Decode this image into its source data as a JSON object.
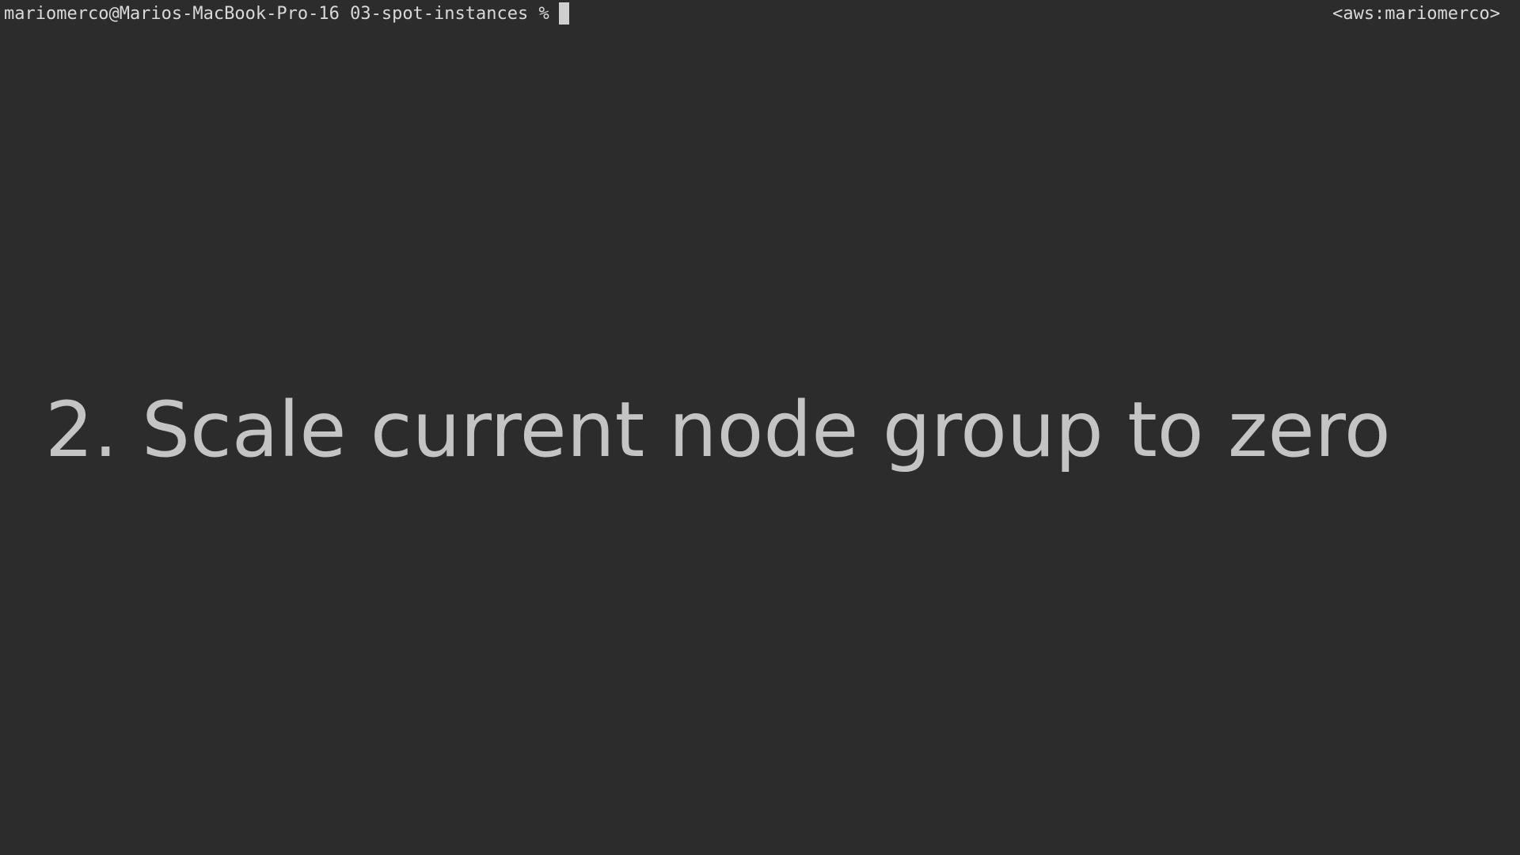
{
  "terminal": {
    "prompt": "mariomerco@Marios-MacBook-Pro-16 03-spot-instances %",
    "right_prompt": "<aws:mariomerco>",
    "cursor_icon": "block-cursor-icon"
  },
  "overlay": {
    "title": "2. Scale current node group to zero"
  },
  "colors": {
    "background": "#2c2c2c",
    "text": "#d9d9d9",
    "overlay_text": "#c4c4c4",
    "cursor": "#cfcfcf"
  }
}
